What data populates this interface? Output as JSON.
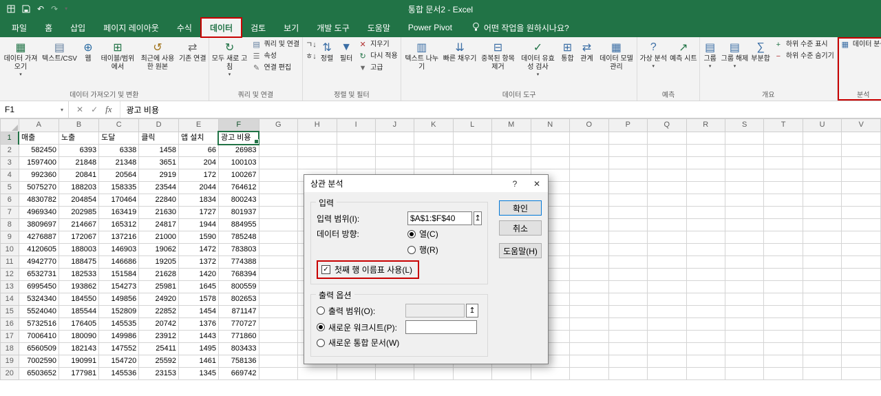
{
  "titlebar": {
    "title": "통합 문서2  -  Excel"
  },
  "tabs": {
    "items": [
      {
        "id": "file",
        "label": "파일"
      },
      {
        "id": "home",
        "label": "홈"
      },
      {
        "id": "insert",
        "label": "삽입"
      },
      {
        "id": "page-layout",
        "label": "페이지 레이아웃"
      },
      {
        "id": "formulas",
        "label": "수식"
      },
      {
        "id": "data",
        "label": "데이터",
        "active": true,
        "annotated": true
      },
      {
        "id": "review",
        "label": "검토"
      },
      {
        "id": "view",
        "label": "보기"
      },
      {
        "id": "developer",
        "label": "개발 도구"
      },
      {
        "id": "help",
        "label": "도움말"
      },
      {
        "id": "power-pivot",
        "label": "Power Pivot"
      }
    ],
    "tell_me": "어떤 작업을 원하시나요?"
  },
  "ribbon": {
    "groups": [
      {
        "name_label": "데이터 가져오기 및 변환",
        "items": [
          {
            "name": "get-data-button",
            "label": "데이터 가져오기",
            "icon": "▦",
            "icon_color": "#217346",
            "arrow": true
          },
          {
            "name": "from-text-csv-button",
            "label": "텍스트/CSV",
            "icon": "▤",
            "icon_color": "#607d9d"
          },
          {
            "name": "from-web-button",
            "label": "웹",
            "icon": "⊕",
            "icon_color": "#2b6ca3"
          },
          {
            "name": "from-table-range-button",
            "label": "테이블/범위에서",
            "icon": "⊞",
            "icon_color": "#217346"
          },
          {
            "name": "recent-sources-button",
            "label": "최근에 사용한 원본",
            "icon": "↺",
            "icon_color": "#a07218"
          },
          {
            "name": "existing-connections-button",
            "label": "기존 연결",
            "icon": "⇄",
            "icon_color": "#6a6a6a"
          }
        ]
      },
      {
        "name_label": "쿼리 및 연결",
        "items": [
          {
            "name": "refresh-all-button",
            "label": "모두 새로 고침",
            "icon": "↻",
            "icon_color": "#217346",
            "arrow": true
          },
          {
            "stack": [
              {
                "name": "queries-connections-button",
                "label": "쿼리 및 연결",
                "icon": "▤",
                "icon_color": "#607d9d"
              },
              {
                "name": "properties-button",
                "label": "속성",
                "icon": "☰",
                "icon_color": "#6a6a6a"
              },
              {
                "name": "edit-links-button",
                "label": "연결 편집",
                "icon": "✎",
                "icon_color": "#6a6a6a"
              }
            ]
          }
        ]
      },
      {
        "name_label": "정렬 및 필터",
        "items": [
          {
            "stack": [
              {
                "name": "sort-ascending-button",
                "label": "",
                "icon": "ㄱ↓",
                "icon_color": "#444444"
              },
              {
                "name": "sort-descending-button",
                "label": "",
                "icon": "ㅎ↓",
                "icon_color": "#444444"
              }
            ]
          },
          {
            "name": "sort-button",
            "label": "정렬",
            "icon": "⇅",
            "icon_color": "#3b6ea5"
          },
          {
            "name": "filter-button",
            "label": "필터",
            "icon": "▼",
            "icon_color": "#3b6ea5"
          },
          {
            "stack": [
              {
                "name": "clear-filter-button",
                "label": "지우기",
                "icon": "✕",
                "icon_color": "#b03030"
              },
              {
                "name": "reapply-button",
                "label": "다시 적용",
                "icon": "↻",
                "icon_color": "#217346"
              },
              {
                "name": "advanced-filter-button",
                "label": "고급",
                "icon": "▼",
                "icon_color": "#6a6a6a"
              }
            ]
          }
        ]
      },
      {
        "name_label": "데이터 도구",
        "items": [
          {
            "name": "text-to-columns-button",
            "label": "텍스트 나누기",
            "icon": "▥",
            "icon_color": "#3b6ea5"
          },
          {
            "name": "flash-fill-button",
            "label": "빠른 채우기",
            "icon": "⇊",
            "icon_color": "#3b6ea5"
          },
          {
            "name": "remove-duplicates-button",
            "label": "중복된 항목 제거",
            "icon": "⊟",
            "icon_color": "#3b6ea5"
          },
          {
            "name": "data-validation-button",
            "label": "데이터 유효성 검사",
            "icon": "✓",
            "icon_color": "#217346",
            "arrow": true
          },
          {
            "name": "consolidate-button",
            "label": "통합",
            "icon": "⊞",
            "icon_color": "#3b6ea5"
          },
          {
            "name": "relationships-button",
            "label": "관계",
            "icon": "⇄",
            "icon_color": "#3b6ea5"
          },
          {
            "name": "manage-data-model-button",
            "label": "데이터 모델 관리",
            "icon": "▦",
            "icon_color": "#3b6ea5"
          }
        ]
      },
      {
        "name_label": "예측",
        "items": [
          {
            "name": "what-if-analysis-button",
            "label": "가상 분석",
            "icon": "?",
            "icon_color": "#3b6ea5",
            "arrow": true
          },
          {
            "name": "forecast-sheet-button",
            "label": "예측 시트",
            "icon": "↗",
            "icon_color": "#217346"
          }
        ]
      },
      {
        "name_label": "개요",
        "items": [
          {
            "name": "group-button",
            "label": "그룹",
            "icon": "▤",
            "icon_color": "#3b6ea5",
            "arrow": true
          },
          {
            "name": "ungroup-button",
            "label": "그룹 해제",
            "icon": "▤",
            "icon_color": "#3b6ea5",
            "arrow": true
          },
          {
            "name": "subtotal-button",
            "label": "부분합",
            "icon": "∑",
            "icon_color": "#3b6ea5"
          },
          {
            "stack": [
              {
                "name": "show-detail-button",
                "label": "하위 수준 표시",
                "icon": "+",
                "icon_color": "#217346"
              },
              {
                "name": "hide-detail-button",
                "label": "하위 수준 숨기기",
                "icon": "−",
                "icon_color": "#b03030"
              }
            ]
          }
        ]
      },
      {
        "name_label": "분석",
        "annotated": true,
        "items": [
          {
            "stack": [
              {
                "name": "data-analysis-button",
                "label": "데이터 분석",
                "icon": "▦",
                "icon_color": "#3b6ea5"
              }
            ]
          }
        ]
      }
    ]
  },
  "formula_bar": {
    "name_box": "F1",
    "content": "광고 비용"
  },
  "icons": {
    "undo": "↶",
    "redo": "↷",
    "dropdown": "▾",
    "cancel": "✕",
    "enter": "✓",
    "fx": "fx",
    "range_picker": "↥",
    "check": "✓",
    "help": "?",
    "close": "✕"
  },
  "grid": {
    "column_letters": [
      "A",
      "B",
      "C",
      "D",
      "E",
      "F",
      "G",
      "H",
      "I",
      "J",
      "K",
      "L",
      "M",
      "N",
      "O",
      "P",
      "Q",
      "R",
      "S",
      "T",
      "U",
      "V"
    ],
    "selected_column_index": 5,
    "selected_row_number": 1,
    "selected_cell": {
      "row": 1,
      "col_index": 5
    },
    "rows": [
      {
        "n": 1,
        "cells": [
          "매출",
          "노출",
          "도달",
          "클릭",
          "앱 설치",
          "광고 비용"
        ]
      },
      {
        "n": 2,
        "cells": [
          "582450",
          "6393",
          "6338",
          "1458",
          "66",
          "26983"
        ]
      },
      {
        "n": 3,
        "cells": [
          "1597400",
          "21848",
          "21348",
          "3651",
          "204",
          "100103"
        ]
      },
      {
        "n": 4,
        "cells": [
          "992360",
          "20841",
          "20564",
          "2919",
          "172",
          "100267"
        ]
      },
      {
        "n": 5,
        "cells": [
          "5075270",
          "188203",
          "158335",
          "23544",
          "2044",
          "764612"
        ]
      },
      {
        "n": 6,
        "cells": [
          "4830782",
          "204854",
          "170464",
          "22840",
          "1834",
          "800243"
        ]
      },
      {
        "n": 7,
        "cells": [
          "4969340",
          "202985",
          "163419",
          "21630",
          "1727",
          "801937"
        ]
      },
      {
        "n": 8,
        "cells": [
          "3809697",
          "214667",
          "165312",
          "24817",
          "1944",
          "884955"
        ]
      },
      {
        "n": 9,
        "cells": [
          "4276887",
          "172067",
          "137216",
          "21000",
          "1590",
          "785248"
        ]
      },
      {
        "n": 10,
        "cells": [
          "4120605",
          "188003",
          "146903",
          "19062",
          "1472",
          "783803"
        ]
      },
      {
        "n": 11,
        "cells": [
          "4942770",
          "188475",
          "146686",
          "19205",
          "1372",
          "774388"
        ]
      },
      {
        "n": 12,
        "cells": [
          "6532731",
          "182533",
          "151584",
          "21628",
          "1420",
          "768394"
        ]
      },
      {
        "n": 13,
        "cells": [
          "6995450",
          "193862",
          "154273",
          "25981",
          "1645",
          "800559"
        ]
      },
      {
        "n": 14,
        "cells": [
          "5324340",
          "184550",
          "149856",
          "24920",
          "1578",
          "802653"
        ]
      },
      {
        "n": 15,
        "cells": [
          "5524040",
          "185544",
          "152809",
          "22852",
          "1454",
          "871147"
        ]
      },
      {
        "n": 16,
        "cells": [
          "5732516",
          "176405",
          "145535",
          "20742",
          "1376",
          "770727"
        ]
      },
      {
        "n": 17,
        "cells": [
          "7006410",
          "180090",
          "149986",
          "23912",
          "1443",
          "771860"
        ]
      },
      {
        "n": 18,
        "cells": [
          "6560509",
          "182143",
          "147552",
          "25411",
          "1495",
          "803433"
        ]
      },
      {
        "n": 19,
        "cells": [
          "7002590",
          "190991",
          "154720",
          "25592",
          "1461",
          "758136"
        ]
      },
      {
        "n": 20,
        "cells": [
          "6503652",
          "177981",
          "145536",
          "23153",
          "1345",
          "669742"
        ]
      }
    ]
  },
  "dialog": {
    "title": "상관 분석",
    "help_button": "?",
    "close_button": "✕",
    "input_group": {
      "label": "입력",
      "input_range_label": "입력 범위(I):",
      "input_range_value": "$A$1:$F$40",
      "orientation_label": "데이터 방향:",
      "radio_columns": "열(C)",
      "radio_rows": "행(R)",
      "labels_checkbox": "첫째 행 이름표 사용(L)"
    },
    "output_group": {
      "label": "출력 옵션",
      "radio_output_range": "출력 범위(O):",
      "radio_new_worksheet": "새로운 워크시트(P):",
      "radio_new_workbook": "새로운 통합 문서(W)"
    },
    "buttons": {
      "ok": "확인",
      "cancel": "취소",
      "help": "도움말(H)"
    }
  },
  "annotation_color": "#c80000"
}
